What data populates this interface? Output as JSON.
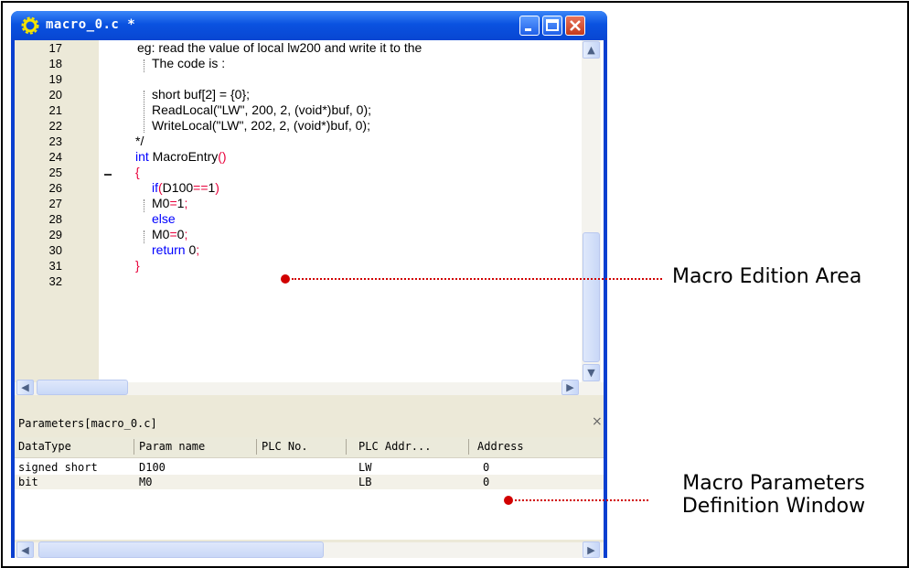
{
  "window": {
    "title": "macro_0.c *",
    "controls": {
      "minimize": "minimize-icon",
      "maximize": "maximize-icon",
      "close": "close-icon"
    }
  },
  "editor": {
    "line_numbers": [
      "17",
      "18",
      "19",
      "20",
      "21",
      "22",
      "23",
      "24",
      "25",
      "26",
      "27",
      "28",
      "29",
      "30",
      "31",
      "32"
    ],
    "code": {
      "l17": "eg: read the value of local lw200 and write it to the",
      "l18": "The code is :",
      "l20": "short buf[2] = {0};",
      "l21": "ReadLocal(\"LW\", 200, 2, (void*)buf, 0);",
      "l22": "WriteLocal(\"LW\", 202, 2, (void*)buf, 0);",
      "l23": "*/",
      "l24_kw": "int",
      "l24_name": " MacroEntry",
      "l24_paren": "()",
      "l25": "{",
      "l26_kw": "if",
      "l26_a": "(",
      "l26_b": "D100",
      "l26_c": "==",
      "l26_d": "1",
      "l26_e": ")",
      "l27_a": "M0",
      "l27_b": "=",
      "l27_c": "1",
      "l27_d": ";",
      "l28": "else",
      "l29_a": "M0",
      "l29_b": "=",
      "l29_c": "0",
      "l29_d": ";",
      "l30_kw": "return",
      "l30_val": " 0",
      "l30_semi": ";",
      "l31": "}"
    }
  },
  "parameters": {
    "title": "Parameters[macro_0.c]",
    "close_glyph": "×",
    "columns": [
      "DataType",
      "Param name",
      "PLC No.",
      "PLC Addr...",
      "Address"
    ],
    "rows": [
      [
        "signed short",
        "D100",
        "",
        "LW",
        "0"
      ],
      [
        "bit",
        "M0",
        "",
        "LB",
        "0"
      ]
    ]
  },
  "annotations": {
    "edition_area": "Macro Edition Area",
    "params_line1": "Macro Parameters",
    "params_line2": "Definition Window"
  },
  "colors": {
    "keyword": "#0000ff",
    "brace": "#e8003a",
    "annotation": "#d10000",
    "titlebar": "#0a52e0"
  }
}
